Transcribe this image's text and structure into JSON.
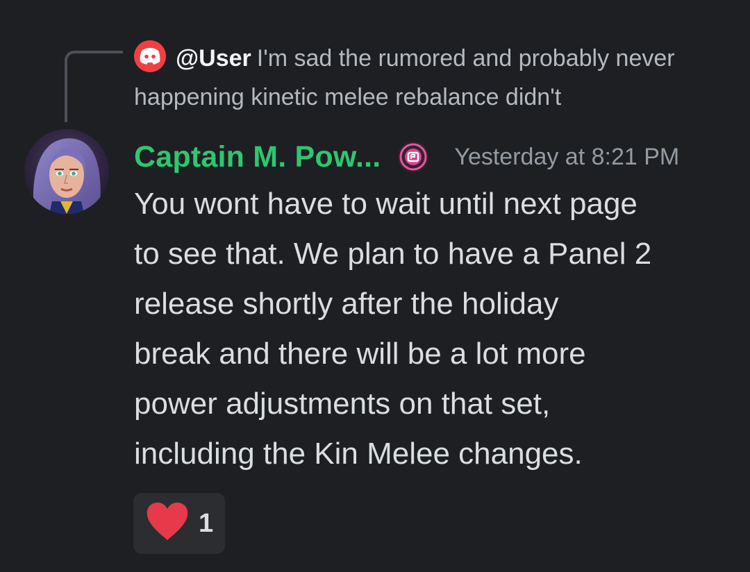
{
  "reply": {
    "username": "@User",
    "text": "I'm sad the rumored and probably never happening kinetic melee rebalance didn't",
    "avatar_icon": "discord-logo-icon"
  },
  "message": {
    "author": "Captain M. Pow...",
    "role_icon": "badge-icon",
    "timestamp": "Yesterday at 8:21 PM",
    "lines": [
      "You wont have to wait until next page",
      "to see that. We plan to have a Panel 2",
      "release shortly after the holiday",
      "break and there will be a lot more",
      "power adjustments on that set,",
      "including the Kin Melee changes."
    ]
  },
  "reaction": {
    "emoji": "heart-icon",
    "count": "1"
  },
  "colors": {
    "background": "#1e1f22",
    "author": "#2dc770",
    "reply_avatar": "#f23f43",
    "reaction_bg": "#2b2d31",
    "heart": "#e6394a"
  }
}
